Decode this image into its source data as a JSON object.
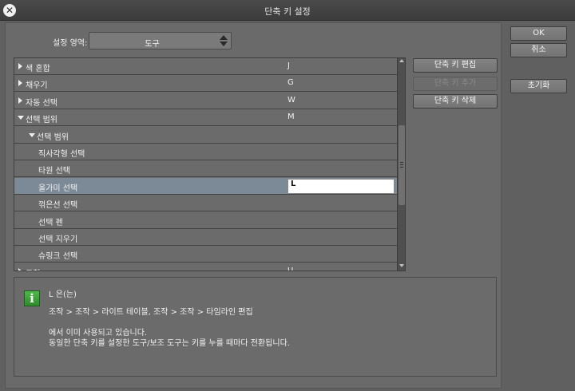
{
  "window": {
    "title": "단축 키 설정"
  },
  "scope": {
    "label": "설정 영역:",
    "value": "도구"
  },
  "tree_rows": [
    {
      "name": "색 혼합",
      "key": "J",
      "level": 0,
      "expander": "collapsed"
    },
    {
      "name": "채우기",
      "key": "G",
      "level": 0,
      "expander": "collapsed"
    },
    {
      "name": "자동 선택",
      "key": "W",
      "level": 0,
      "expander": "collapsed"
    },
    {
      "name": "선택 범위",
      "key": "M",
      "level": 0,
      "expander": "expanded"
    },
    {
      "name": "선택 범위",
      "key": "",
      "level": 1,
      "expander": "expanded"
    },
    {
      "name": "직사각형 선택",
      "key": "",
      "level": 2,
      "expander": "none"
    },
    {
      "name": "타원 선택",
      "key": "",
      "level": 2,
      "expander": "none"
    },
    {
      "name": "올가미 선택",
      "key": "L",
      "level": 2,
      "expander": "none",
      "selected": true
    },
    {
      "name": "꺾은선 선택",
      "key": "",
      "level": 2,
      "expander": "none"
    },
    {
      "name": "선택 펜",
      "key": "",
      "level": 2,
      "expander": "none"
    },
    {
      "name": "선택 지우기",
      "key": "",
      "level": 2,
      "expander": "none"
    },
    {
      "name": "슈링크 선택",
      "key": "",
      "level": 2,
      "expander": "none"
    },
    {
      "name": "도형",
      "key": "U",
      "level": 0,
      "expander": "collapsed"
    }
  ],
  "shortcut_buttons": {
    "edit": "단축 키 편집",
    "add": "단축 키 추가",
    "delete": "단축 키 삭제"
  },
  "dialog_buttons": {
    "ok": "OK",
    "cancel": "취소",
    "reset": "초기화"
  },
  "info": {
    "icon": "info-icon",
    "line1": "L 은(는)",
    "line2": "조작 > 조작 > 라이트 테이블, 조작 > 조작 > 타임라인 편집",
    "line3": "에서 이미 사용되고 있습니다.",
    "line4": "동일한 단축 키를 설정한 도구/보조 도구는 키를 누를 때마다 전환됩니다."
  },
  "colors": {
    "selection": "#7c8a98",
    "info_icon": "#3a9e36",
    "background": "#606060"
  }
}
